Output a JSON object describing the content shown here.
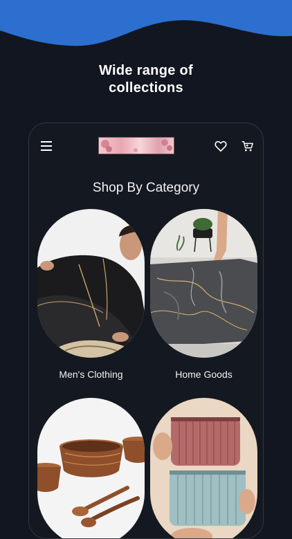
{
  "promo": {
    "line1": "Wide range of",
    "line2": "collections",
    "wave_color": "#2c6fcf"
  },
  "app_header": {
    "menu_icon": "menu-icon",
    "logo_name": "store-logo",
    "wishlist_icon": "heart-icon",
    "cart_icon": "cart-icon"
  },
  "section": {
    "title": "Shop By Category"
  },
  "categories": [
    {
      "label": "Men's Clothing"
    },
    {
      "label": "Home Goods"
    },
    {
      "label": ""
    },
    {
      "label": ""
    }
  ],
  "colors": {
    "background": "#121620",
    "accent": "#2c6fcf"
  }
}
